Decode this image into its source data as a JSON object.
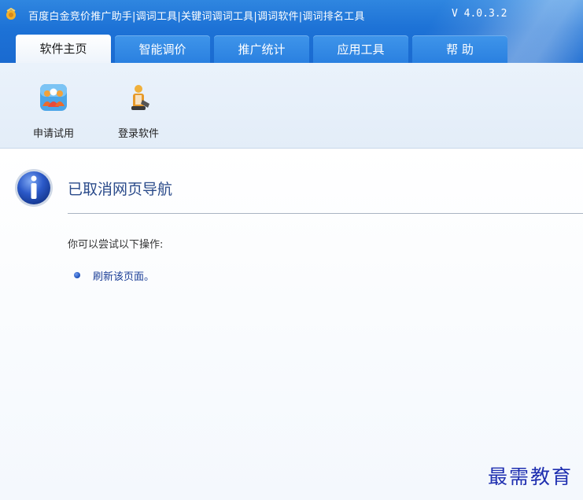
{
  "titlebar": {
    "title": "百度白金竞价推广助手|调词工具|关键词调词工具|调词软件|调词排名工具",
    "version": "V 4.0.3.2",
    "app_icon": "app-logo-icon"
  },
  "tabs": [
    {
      "label": "软件主页",
      "active": true
    },
    {
      "label": "智能调价",
      "active": false
    },
    {
      "label": "推广统计",
      "active": false
    },
    {
      "label": "应用工具",
      "active": false
    },
    {
      "label": "帮  助",
      "active": false
    }
  ],
  "toolbar": {
    "items": [
      {
        "label": "申请试用",
        "icon": "people-icon"
      },
      {
        "label": "登录软件",
        "icon": "user-login-icon"
      }
    ]
  },
  "content": {
    "icon": "info-icon",
    "heading": "已取消网页导航",
    "hint": "你可以尝试以下操作:",
    "actions": [
      {
        "label": "刷新该页面。"
      }
    ]
  },
  "watermark": "最需教育",
  "colors": {
    "titlebar_blue": "#1d72d6",
    "heading_blue": "#2a4a8a",
    "link_blue": "#1a3d96",
    "watermark_blue": "#1f2fb0"
  }
}
